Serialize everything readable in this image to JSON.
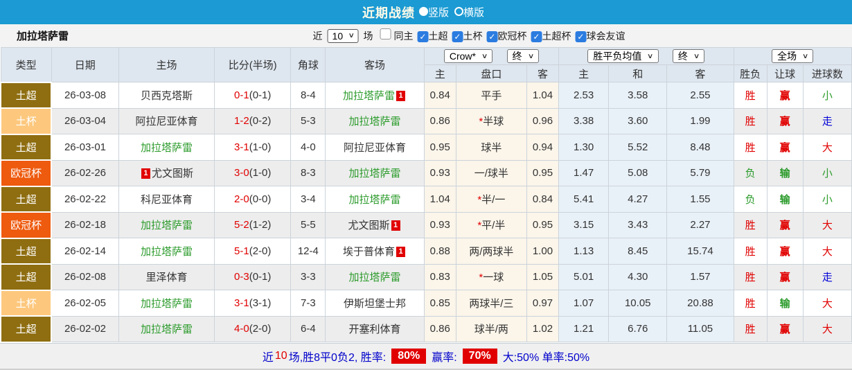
{
  "title_bar": {
    "title": "近期战绩",
    "layout_options": [
      {
        "label": "竖版",
        "selected": true
      },
      {
        "label": "横版",
        "selected": false
      }
    ]
  },
  "filter_bar": {
    "team_name": "加拉塔萨雷",
    "recent_label": "近",
    "recent_count": "10",
    "matches_label": "场",
    "checkboxes": [
      {
        "label": "同主",
        "checked": false
      },
      {
        "label": "土超",
        "checked": true
      },
      {
        "label": "土杯",
        "checked": true
      },
      {
        "label": "欧冠杯",
        "checked": true
      },
      {
        "label": "土超杯",
        "checked": true
      },
      {
        "label": "球会友谊",
        "checked": true
      }
    ]
  },
  "table": {
    "headers": {
      "type": "类型",
      "date": "日期",
      "home": "主场",
      "score": "比分(半场)",
      "corners": "角球",
      "away": "客场",
      "ah_home": "主",
      "ah_line": "盘口",
      "ah_away": "客",
      "avg_home": "主",
      "avg_draw": "和",
      "avg_away": "客",
      "result_wl": "胜负",
      "result_handicap": "让球",
      "result_goals": "进球数"
    },
    "dropdowns": {
      "odds_company": "Crow*",
      "odds_company_time": "终",
      "avg_source": "胜平负均值",
      "avg_time": "终",
      "scope": "全场"
    },
    "type_colors": {
      "土超": "#8f6e11",
      "土杯": "#fdc87e",
      "欧冠杯": "#ee5a0e"
    },
    "rows": [
      {
        "type": "土超",
        "date": "26-03-08",
        "home": {
          "name": "贝西克塔斯",
          "green": false,
          "badge": "",
          "badge_pos": ""
        },
        "score": {
          "ft": "0-1",
          "ht": "(0-1)"
        },
        "corners": "8-4",
        "away": {
          "name": "加拉塔萨雷",
          "green": true,
          "badge": "1",
          "badge_pos": "after"
        },
        "ah": {
          "home": "0.84",
          "star": "",
          "line": "平手",
          "away": "1.04"
        },
        "avg": {
          "home": "2.53",
          "draw": "3.58",
          "away": "2.55"
        },
        "results": {
          "wl": {
            "text": "胜",
            "color": "red"
          },
          "handicap": {
            "text": "赢",
            "color": "red"
          },
          "goals": {
            "text": "小",
            "color": "green"
          }
        }
      },
      {
        "type": "土杯",
        "date": "26-03-04",
        "home": {
          "name": "阿拉尼亚体育",
          "green": false,
          "badge": "",
          "badge_pos": ""
        },
        "score": {
          "ft": "1-2",
          "ht": "(0-2)"
        },
        "corners": "5-3",
        "away": {
          "name": "加拉塔萨雷",
          "green": true,
          "badge": "",
          "badge_pos": ""
        },
        "ah": {
          "home": "0.86",
          "star": "*",
          "line": "半球",
          "away": "0.96"
        },
        "avg": {
          "home": "3.38",
          "draw": "3.60",
          "away": "1.99"
        },
        "results": {
          "wl": {
            "text": "胜",
            "color": "red"
          },
          "handicap": {
            "text": "赢",
            "color": "red"
          },
          "goals": {
            "text": "走",
            "color": "blue"
          }
        }
      },
      {
        "type": "土超",
        "date": "26-03-01",
        "home": {
          "name": "加拉塔萨雷",
          "green": true,
          "badge": "",
          "badge_pos": ""
        },
        "score": {
          "ft": "3-1",
          "ht": "(1-0)"
        },
        "corners": "4-0",
        "away": {
          "name": "阿拉尼亚体育",
          "green": false,
          "badge": "",
          "badge_pos": ""
        },
        "ah": {
          "home": "0.95",
          "star": "",
          "line": "球半",
          "away": "0.94"
        },
        "avg": {
          "home": "1.30",
          "draw": "5.52",
          "away": "8.48"
        },
        "results": {
          "wl": {
            "text": "胜",
            "color": "red"
          },
          "handicap": {
            "text": "赢",
            "color": "red"
          },
          "goals": {
            "text": "大",
            "color": "red"
          }
        }
      },
      {
        "type": "欧冠杯",
        "date": "26-02-26",
        "home": {
          "name": "尤文图斯",
          "green": false,
          "badge": "1",
          "badge_pos": "before"
        },
        "score": {
          "ft": "3-0",
          "ht": "(1-0)"
        },
        "corners": "8-3",
        "away": {
          "name": "加拉塔萨雷",
          "green": true,
          "badge": "",
          "badge_pos": ""
        },
        "ah": {
          "home": "0.93",
          "star": "",
          "line": "一/球半",
          "away": "0.95"
        },
        "avg": {
          "home": "1.47",
          "draw": "5.08",
          "away": "5.79"
        },
        "results": {
          "wl": {
            "text": "负",
            "color": "green"
          },
          "handicap": {
            "text": "输",
            "color": "green"
          },
          "goals": {
            "text": "小",
            "color": "green"
          }
        }
      },
      {
        "type": "土超",
        "date": "26-02-22",
        "home": {
          "name": "科尼亚体育",
          "green": false,
          "badge": "",
          "badge_pos": ""
        },
        "score": {
          "ft": "2-0",
          "ht": "(0-0)"
        },
        "corners": "3-4",
        "away": {
          "name": "加拉塔萨雷",
          "green": true,
          "badge": "",
          "badge_pos": ""
        },
        "ah": {
          "home": "1.04",
          "star": "*",
          "line": "半/一",
          "away": "0.84"
        },
        "avg": {
          "home": "5.41",
          "draw": "4.27",
          "away": "1.55"
        },
        "results": {
          "wl": {
            "text": "负",
            "color": "green"
          },
          "handicap": {
            "text": "输",
            "color": "green"
          },
          "goals": {
            "text": "小",
            "color": "green"
          }
        }
      },
      {
        "type": "欧冠杯",
        "date": "26-02-18",
        "home": {
          "name": "加拉塔萨雷",
          "green": true,
          "badge": "",
          "badge_pos": ""
        },
        "score": {
          "ft": "5-2",
          "ht": "(1-2)"
        },
        "corners": "5-5",
        "away": {
          "name": "尤文图斯",
          "green": false,
          "badge": "1",
          "badge_pos": "after"
        },
        "ah": {
          "home": "0.93",
          "star": "*",
          "line": "平/半",
          "away": "0.95"
        },
        "avg": {
          "home": "3.15",
          "draw": "3.43",
          "away": "2.27"
        },
        "results": {
          "wl": {
            "text": "胜",
            "color": "red"
          },
          "handicap": {
            "text": "赢",
            "color": "red"
          },
          "goals": {
            "text": "大",
            "color": "red"
          }
        }
      },
      {
        "type": "土超",
        "date": "26-02-14",
        "home": {
          "name": "加拉塔萨雷",
          "green": true,
          "badge": "",
          "badge_pos": ""
        },
        "score": {
          "ft": "5-1",
          "ht": "(2-0)"
        },
        "corners": "12-4",
        "away": {
          "name": "埃于普体育",
          "green": false,
          "badge": "1",
          "badge_pos": "after"
        },
        "ah": {
          "home": "0.88",
          "star": "",
          "line": "两/两球半",
          "away": "1.00"
        },
        "avg": {
          "home": "1.13",
          "draw": "8.45",
          "away": "15.74"
        },
        "results": {
          "wl": {
            "text": "胜",
            "color": "red"
          },
          "handicap": {
            "text": "赢",
            "color": "red"
          },
          "goals": {
            "text": "大",
            "color": "red"
          }
        }
      },
      {
        "type": "土超",
        "date": "26-02-08",
        "home": {
          "name": "里泽体育",
          "green": false,
          "badge": "",
          "badge_pos": ""
        },
        "score": {
          "ft": "0-3",
          "ht": "(0-1)"
        },
        "corners": "3-3",
        "away": {
          "name": "加拉塔萨雷",
          "green": true,
          "badge": "",
          "badge_pos": ""
        },
        "ah": {
          "home": "0.83",
          "star": "*",
          "line": "一球",
          "away": "1.05"
        },
        "avg": {
          "home": "5.01",
          "draw": "4.30",
          "away": "1.57"
        },
        "results": {
          "wl": {
            "text": "胜",
            "color": "red"
          },
          "handicap": {
            "text": "赢",
            "color": "red"
          },
          "goals": {
            "text": "走",
            "color": "blue"
          }
        }
      },
      {
        "type": "土杯",
        "date": "26-02-05",
        "home": {
          "name": "加拉塔萨雷",
          "green": true,
          "badge": "",
          "badge_pos": ""
        },
        "score": {
          "ft": "3-1",
          "ht": "(3-1)"
        },
        "corners": "7-3",
        "away": {
          "name": "伊斯坦堡士邦",
          "green": false,
          "badge": "",
          "badge_pos": ""
        },
        "ah": {
          "home": "0.85",
          "star": "",
          "line": "两球半/三",
          "away": "0.97"
        },
        "avg": {
          "home": "1.07",
          "draw": "10.05",
          "away": "20.88"
        },
        "results": {
          "wl": {
            "text": "胜",
            "color": "red"
          },
          "handicap": {
            "text": "输",
            "color": "green"
          },
          "goals": {
            "text": "大",
            "color": "red"
          }
        }
      },
      {
        "type": "土超",
        "date": "26-02-02",
        "home": {
          "name": "加拉塔萨雷",
          "green": true,
          "badge": "",
          "badge_pos": ""
        },
        "score": {
          "ft": "4-0",
          "ht": "(2-0)"
        },
        "corners": "6-4",
        "away": {
          "name": "开塞利体育",
          "green": false,
          "badge": "",
          "badge_pos": ""
        },
        "ah": {
          "home": "0.86",
          "star": "",
          "line": "球半/两",
          "away": "1.02"
        },
        "avg": {
          "home": "1.21",
          "draw": "6.76",
          "away": "11.05"
        },
        "results": {
          "wl": {
            "text": "胜",
            "color": "red"
          },
          "handicap": {
            "text": "赢",
            "color": "red"
          },
          "goals": {
            "text": "大",
            "color": "red"
          }
        }
      }
    ]
  },
  "summary": {
    "prefix": "近",
    "count": "10",
    "middle": "场,胜8平0负2, 胜率:",
    "win_rate": "80%",
    "profit_label": "赢率:",
    "profit_rate": "70%",
    "suffix": "大:50% 单率:50%"
  },
  "colors": {
    "top_bar": "#1b9ad3",
    "header_bg": "#dee6ef",
    "ah_bg": "#fbf5ea",
    "avg_bg": "#e9f1f8",
    "win_red": "#e10000",
    "team_green": "#2c9b2c",
    "push_blue": "#0000d8",
    "checkbox_blue": "#2b7ce0",
    "type_super_lig": "#8f6e11",
    "type_cup": "#fdc87e",
    "type_ucl": "#ee5a0e"
  }
}
